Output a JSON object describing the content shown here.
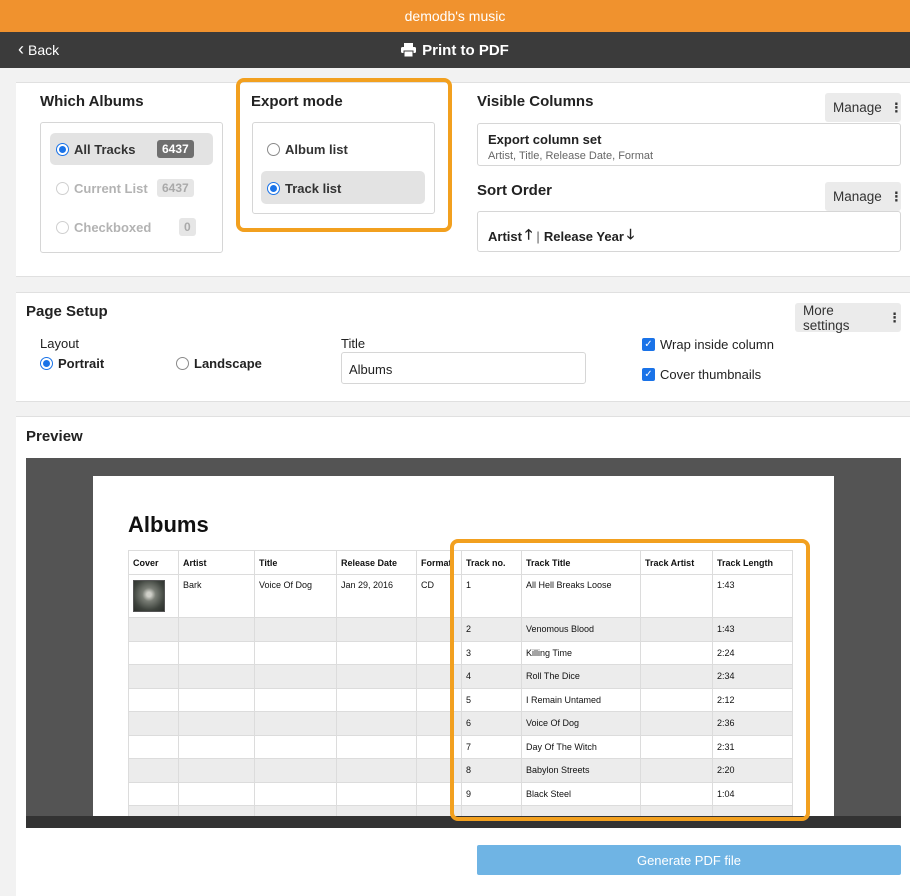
{
  "app": {
    "title": "demodb's music"
  },
  "nav": {
    "back_label": "Back",
    "title": "Print to PDF"
  },
  "which_albums": {
    "heading": "Which Albums",
    "options": [
      {
        "label": "All Tracks",
        "count": "6437",
        "selected": true,
        "enabled": true
      },
      {
        "label": "Current List",
        "count": "6437",
        "selected": false,
        "enabled": false
      },
      {
        "label": "Checkboxed",
        "count": "0",
        "selected": false,
        "enabled": false
      }
    ]
  },
  "export_mode": {
    "heading": "Export mode",
    "options": [
      {
        "label": "Album list",
        "selected": false
      },
      {
        "label": "Track list",
        "selected": true
      }
    ]
  },
  "visible_columns": {
    "heading": "Visible Columns",
    "manage_label": "Manage",
    "set_name": "Export column set",
    "set_columns": "Artist, Title, Release Date, Format"
  },
  "sort_order": {
    "heading": "Sort Order",
    "manage_label": "Manage",
    "keys": [
      {
        "label": "Artist",
        "direction": "ascending"
      },
      {
        "label": "Release Year",
        "direction": "descending"
      }
    ]
  },
  "page_setup": {
    "heading": "Page Setup",
    "more_settings_label": "More settings",
    "layout_label": "Layout",
    "layout_options": [
      {
        "label": "Portrait",
        "selected": true
      },
      {
        "label": "Landscape",
        "selected": false
      }
    ],
    "title_label": "Title",
    "title_value": "Albums",
    "checkboxes": [
      {
        "label": "Wrap inside column",
        "checked": true
      },
      {
        "label": "Cover thumbnails",
        "checked": true
      }
    ]
  },
  "preview": {
    "heading": "Preview",
    "doc_title": "Albums",
    "columns": [
      "Cover",
      "Artist",
      "Title",
      "Release Date",
      "Format",
      "Track no.",
      "Track Title",
      "Track Artist",
      "Track Length"
    ],
    "album": {
      "artist": "Bark",
      "title": "Voice Of Dog",
      "release_date": "Jan 29, 2016",
      "format": "CD"
    },
    "tracks": [
      {
        "no": "1",
        "title": "All Hell Breaks Loose",
        "artist": "",
        "length": "1:43"
      },
      {
        "no": "2",
        "title": "Venomous Blood",
        "artist": "",
        "length": "1:43"
      },
      {
        "no": "3",
        "title": "Killing Time",
        "artist": "",
        "length": "2:24"
      },
      {
        "no": "4",
        "title": "Roll The Dice",
        "artist": "",
        "length": "2:34"
      },
      {
        "no": "5",
        "title": "I Remain Untamed",
        "artist": "",
        "length": "2:12"
      },
      {
        "no": "6",
        "title": "Voice Of Dog",
        "artist": "",
        "length": "2:36"
      },
      {
        "no": "7",
        "title": "Day Of The Witch",
        "artist": "",
        "length": "2:31"
      },
      {
        "no": "8",
        "title": "Babylon Streets",
        "artist": "",
        "length": "2:20"
      },
      {
        "no": "9",
        "title": "Black Steel",
        "artist": "",
        "length": "1:04"
      }
    ]
  },
  "actions": {
    "generate_label": "Generate PDF file"
  },
  "colors": {
    "brand": "#f0922e",
    "highlight": "#f2a01f",
    "accent": "#1a73e8",
    "button": "#6fb4e4"
  }
}
